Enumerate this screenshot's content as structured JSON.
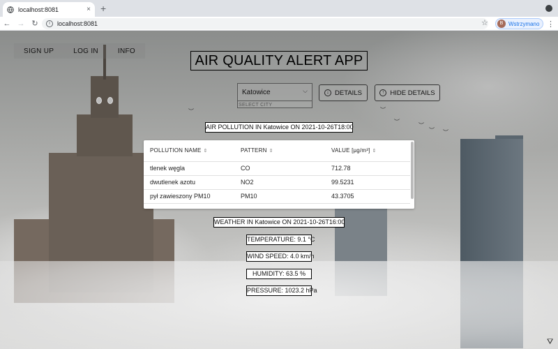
{
  "browser": {
    "tab_title": "localhost:8081",
    "tab_close": "×",
    "new_tab": "+",
    "back": "←",
    "forward": "→",
    "reload": "↻",
    "url": "localhost:8081",
    "star": "☆",
    "profile_initial": "B",
    "profile_label": "Wstrzymano",
    "menu": "⋮"
  },
  "nav": {
    "items": [
      "SIGN UP",
      "LOG IN",
      "INFO"
    ]
  },
  "title": "AIR QUALITY ALERT APP",
  "city_select": {
    "value": "Katowice",
    "label": "SELECT CITY",
    "chevron": "⌵"
  },
  "buttons": {
    "details": "DETAILS",
    "hide_details": "HIDE DETAILS",
    "details_icon": "↓",
    "hide_icon": "↑"
  },
  "air_pollution_label": "AIR POLLUTION IN Katowice ON 2021-10-26T18:00",
  "table": {
    "headers": [
      "POLLUTION NAME",
      "PATTERN",
      "VALUE [µg/m³]"
    ],
    "sort_icon": "⇕",
    "rows": [
      [
        "tlenek węgla",
        "CO",
        "712.78"
      ],
      [
        "dwutlenek azotu",
        "NO2",
        "99.5231"
      ],
      [
        "pył zawieszony PM10",
        "PM10",
        "43.3705"
      ]
    ]
  },
  "weather_label": "WEATHER IN Katowice ON 2021-10-26T16:00",
  "weather": {
    "temperature": "TEMPERATURE: 9.1 °C",
    "wind": "WIND SPEED: 4.0 km/h",
    "humidity": "HUMIDITY: 63.5 %",
    "pressure": "PRESSURE: 1023.2 hPa"
  },
  "icons": {
    "filter": "⛛",
    "bird": "︶"
  }
}
